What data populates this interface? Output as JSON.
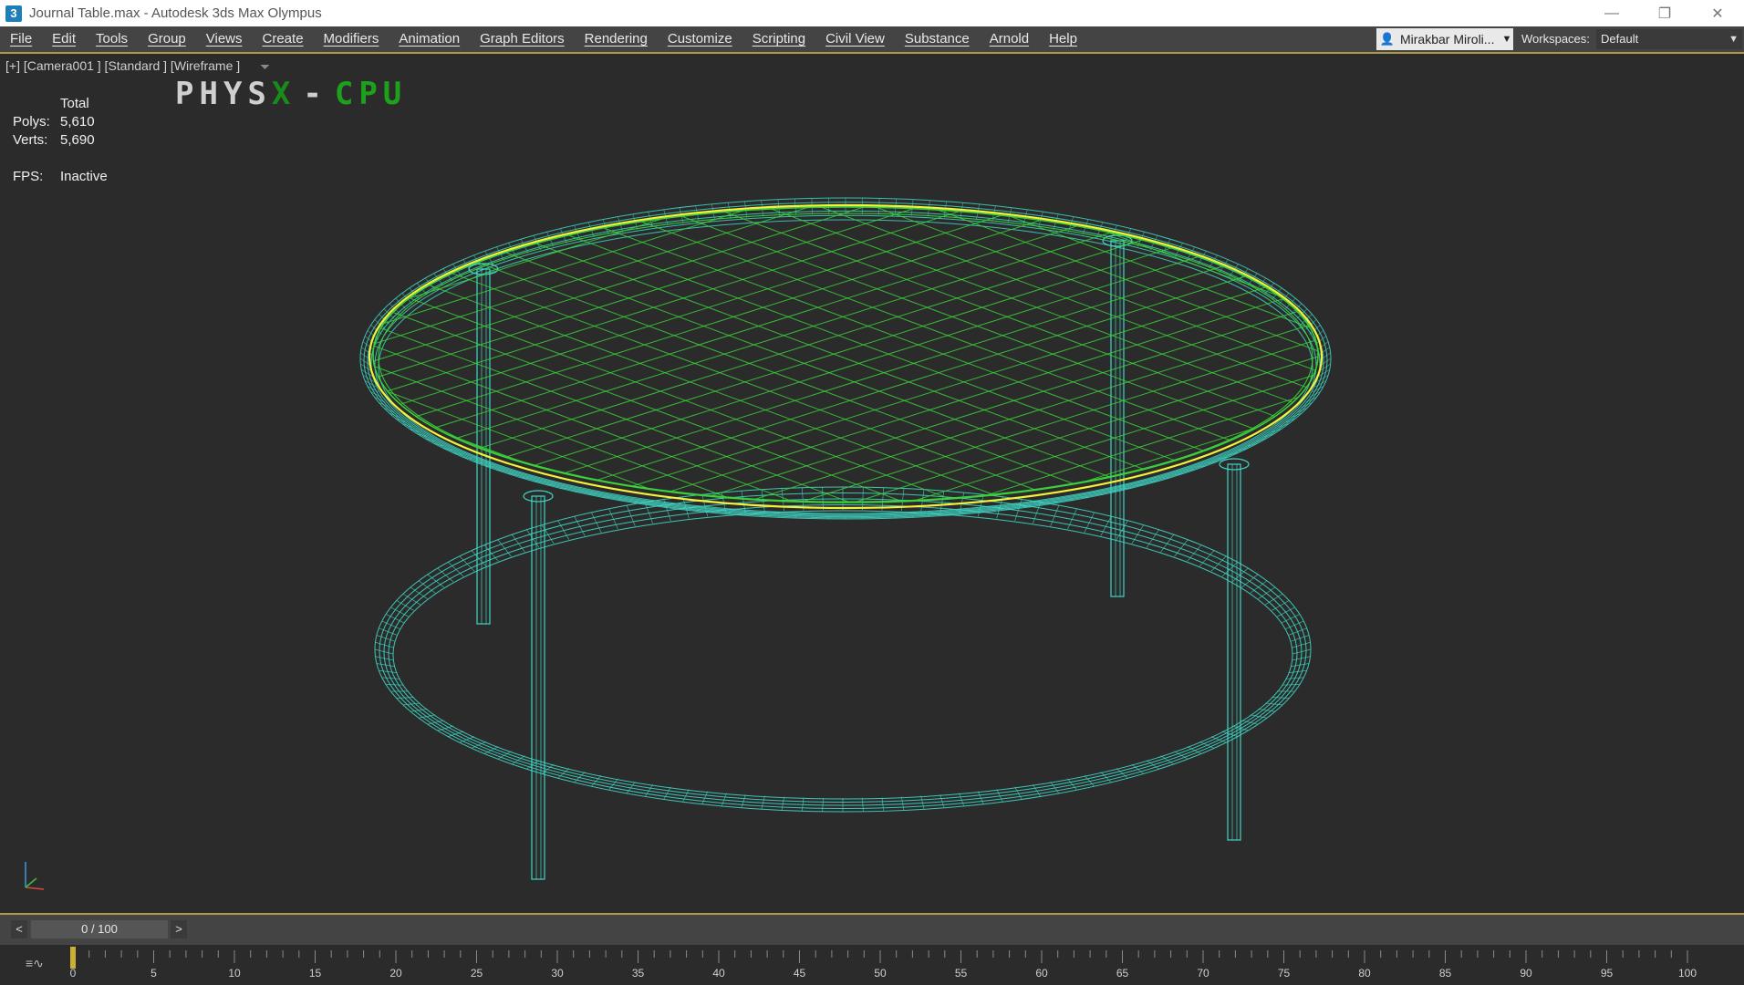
{
  "window": {
    "title": "Journal Table.max - Autodesk 3ds Max Olympus",
    "app_icon_text": "3",
    "controls": {
      "minimize": "—",
      "restore": "❐",
      "close": "✕"
    }
  },
  "menu": {
    "items": [
      "File",
      "Edit",
      "Tools",
      "Group",
      "Views",
      "Create",
      "Modifiers",
      "Animation",
      "Graph Editors",
      "Rendering",
      "Customize",
      "Scripting",
      "Civil View",
      "Substance",
      "Arnold",
      "Help"
    ],
    "user_name": "Mirakbar Miroli...",
    "workspaces_label": "Workspaces:",
    "workspace_value": "Default"
  },
  "viewport": {
    "label": "[+] [Camera001 ] [Standard ] [Wireframe ]",
    "physx_left": "PHYS",
    "physx_x": "X",
    "physx_sep": "-",
    "physx_right": "CPU",
    "stats": {
      "header": "Total",
      "polys_label": "Polys:",
      "polys_value": "5,610",
      "verts_label": "Verts:",
      "verts_value": "5,690",
      "fps_label": "FPS:",
      "fps_value": "Inactive"
    },
    "colors": {
      "wire": "#3fd7c5",
      "top_grid": "#3bd13b",
      "selection": "#f2f23a",
      "background": "#2b2b2b"
    }
  },
  "timeline": {
    "prev": "<",
    "next": ">",
    "frame_display": "0 / 100",
    "current_frame": 0,
    "start": 0,
    "end": 100,
    "tick_labels": [
      "0",
      "5",
      "10",
      "15",
      "20",
      "25",
      "30",
      "35",
      "40",
      "45",
      "50",
      "55",
      "60",
      "65",
      "70",
      "75",
      "80",
      "85",
      "90",
      "95",
      "100"
    ],
    "curve_icon": "≡∿"
  }
}
